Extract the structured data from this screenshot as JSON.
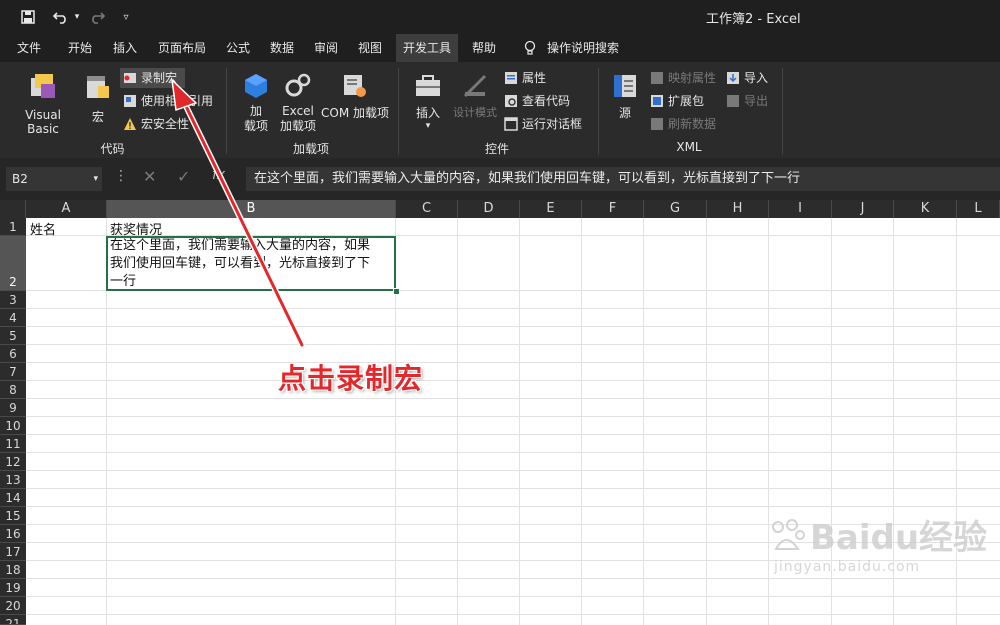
{
  "window": {
    "title": "工作簿2  -  Excel"
  },
  "quick_access": {
    "icons": [
      "save-icon",
      "undo-icon",
      "redo-icon",
      "customize-icon"
    ]
  },
  "menu_tabs": [
    "文件",
    "开始",
    "插入",
    "页面布局",
    "公式",
    "数据",
    "审阅",
    "视图",
    "开发工具",
    "帮助",
    "操作说明搜索"
  ],
  "active_tab": "开发工具",
  "ribbon": {
    "code": {
      "visual_basic": "Visual Basic",
      "macros": "宏",
      "record_macro": "录制宏",
      "relative_ref": "使用相对引用",
      "macro_security": "宏安全性",
      "label": "代码"
    },
    "addins": {
      "addins_line1": "加",
      "addins_line2": "载项",
      "excel_addins_line1": "Excel",
      "excel_addins_line2": "加载项",
      "com_addins": "COM 加载项",
      "label": "加载项"
    },
    "controls": {
      "insert": "插入",
      "design_mode": "设计模式",
      "properties": "属性",
      "view_code": "查看代码",
      "run_dialog": "运行对话框",
      "label": "控件"
    },
    "xml": {
      "source": "源",
      "map_properties": "映射属性",
      "expansion_packs": "扩展包",
      "refresh_data": "刷新数据",
      "import": "导入",
      "export": "导出",
      "label": "XML"
    }
  },
  "formula_bar": {
    "name_box": "B2",
    "formula": "在这个里面，我们需要输入大量的内容，如果我们使用回车键，可以看到，光标直接到了下一行"
  },
  "columns": [
    "A",
    "B",
    "C",
    "D",
    "E",
    "F",
    "G",
    "H",
    "I",
    "J",
    "K",
    "L"
  ],
  "rows": [
    "1",
    "2",
    "3",
    "4",
    "5",
    "6",
    "7",
    "8",
    "9",
    "10",
    "11",
    "12",
    "13",
    "14",
    "15",
    "16",
    "17",
    "18",
    "19",
    "20",
    "21"
  ],
  "cells": {
    "A1": "姓名",
    "B1": "获奖情况",
    "B2_line1": "在这个里面，我们需要输入大量的内容，如果",
    "B2_line2": "我们使用回车键，可以看到，光标直接到了下",
    "B2_line3": "一行"
  },
  "annotation": {
    "text": "点击录制宏",
    "color": "#e3282c"
  },
  "watermark": {
    "brand": "Baidu经验",
    "url": "jingyan.baidu.com"
  },
  "colors": {
    "accent_green": "#217346",
    "dark_bg": "#1f1f1f",
    "ribbon_bg": "#2b2b2b"
  }
}
